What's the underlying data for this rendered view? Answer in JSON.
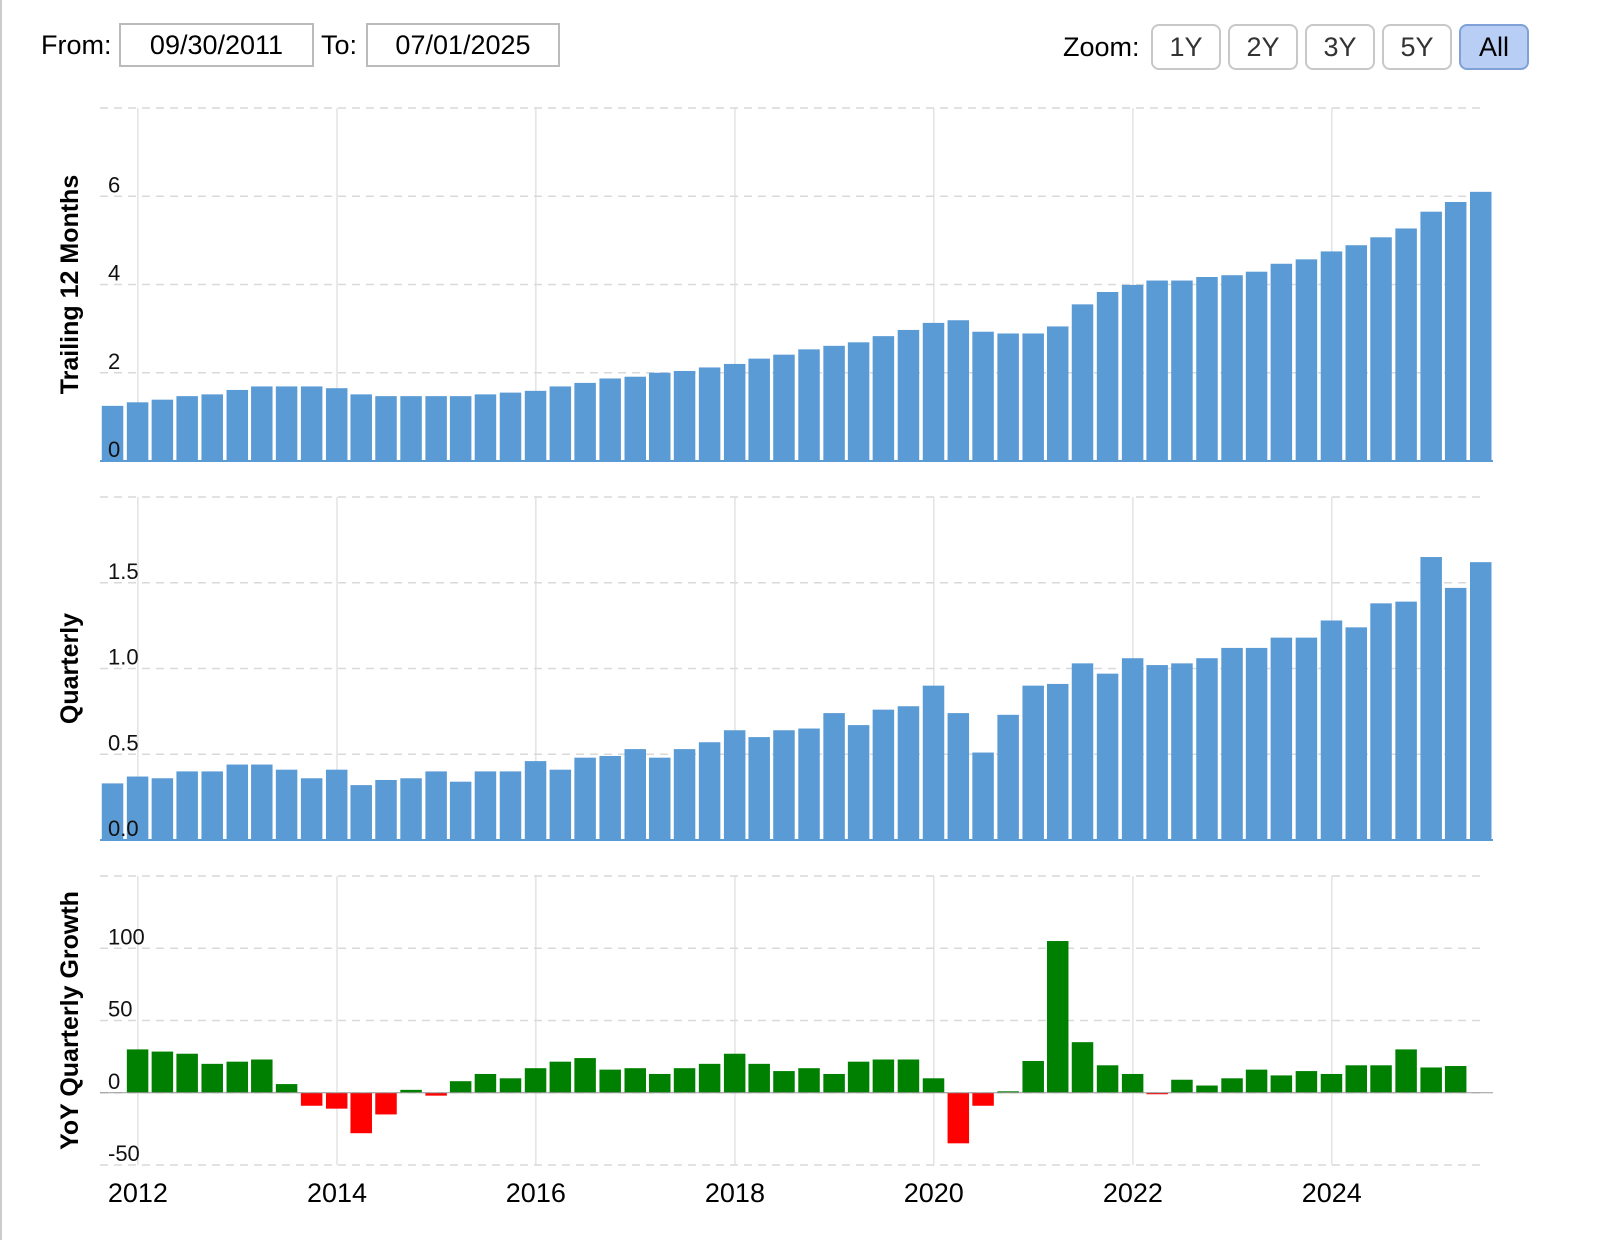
{
  "toolbar": {
    "from_label": "From:",
    "from_value": "09/30/2011",
    "to_label": "To:",
    "to_value": "07/01/2025",
    "zoom_label": "Zoom:",
    "zoom_options": [
      "1Y",
      "2Y",
      "3Y",
      "5Y",
      "All"
    ],
    "zoom_active": "All"
  },
  "colors": {
    "bar_blue": "#5b9bd5",
    "growth_positive": "#008000",
    "growth_negative": "#ff0000",
    "grid": "#d9d9d9",
    "active_zoom_bg": "#b8cef5"
  },
  "chart_data": [
    {
      "type": "bar",
      "ylabel": "Trailing 12 Months",
      "ylim": [
        0,
        8
      ],
      "yticks": [
        0,
        2,
        4,
        6
      ],
      "ytick_labels": [
        "0",
        "2",
        "4",
        "6"
      ],
      "xticks": [
        "2012",
        "2014",
        "2016",
        "2018",
        "2020",
        "2022",
        "2024"
      ],
      "grid": true,
      "x": [
        "2011-09-30",
        "2011-12-31",
        "2012-03-31",
        "2012-06-30",
        "2012-09-30",
        "2012-12-31",
        "2013-03-31",
        "2013-06-30",
        "2013-09-30",
        "2013-12-31",
        "2014-03-31",
        "2014-06-30",
        "2014-09-30",
        "2014-12-31",
        "2015-03-31",
        "2015-06-30",
        "2015-09-30",
        "2015-12-31",
        "2016-03-31",
        "2016-06-30",
        "2016-09-30",
        "2016-12-31",
        "2017-03-31",
        "2017-06-30",
        "2017-09-30",
        "2017-12-31",
        "2018-03-31",
        "2018-06-30",
        "2018-09-30",
        "2018-12-31",
        "2019-03-31",
        "2019-06-30",
        "2019-09-30",
        "2019-12-31",
        "2020-03-31",
        "2020-06-30",
        "2020-09-30",
        "2020-12-31",
        "2021-03-31",
        "2021-06-30",
        "2021-09-30",
        "2021-12-31",
        "2022-03-31",
        "2022-06-30",
        "2022-09-30",
        "2022-12-31",
        "2023-03-31",
        "2023-06-30",
        "2023-09-30",
        "2023-12-31",
        "2024-03-31",
        "2024-06-30",
        "2024-09-30",
        "2024-12-31",
        "2025-03-31",
        "2025-07-01"
      ],
      "values": [
        1.25,
        1.33,
        1.39,
        1.47,
        1.51,
        1.61,
        1.69,
        1.69,
        1.69,
        1.65,
        1.51,
        1.47,
        1.47,
        1.47,
        1.47,
        1.51,
        1.55,
        1.59,
        1.69,
        1.77,
        1.87,
        1.91,
        2.0,
        2.04,
        2.12,
        2.2,
        2.32,
        2.41,
        2.53,
        2.61,
        2.69,
        2.83,
        2.97,
        3.13,
        3.19,
        2.93,
        2.89,
        2.89,
        3.05,
        3.55,
        3.83,
        3.99,
        4.09,
        4.09,
        4.17,
        4.21,
        4.29,
        4.47,
        4.57,
        4.75,
        4.89,
        5.07,
        5.27,
        5.65,
        5.87,
        6.1
      ]
    },
    {
      "type": "bar",
      "ylabel": "Quarterly",
      "ylim": [
        0,
        2
      ],
      "yticks": [
        0,
        0.5,
        1.0,
        1.5
      ],
      "ytick_labels": [
        "0.0",
        "0.5",
        "1.0",
        "1.5"
      ],
      "xticks": [
        "2012",
        "2014",
        "2016",
        "2018",
        "2020",
        "2022",
        "2024"
      ],
      "grid": true,
      "x": [
        "2011-09-30",
        "2011-12-31",
        "2012-03-31",
        "2012-06-30",
        "2012-09-30",
        "2012-12-31",
        "2013-03-31",
        "2013-06-30",
        "2013-09-30",
        "2013-12-31",
        "2014-03-31",
        "2014-06-30",
        "2014-09-30",
        "2014-12-31",
        "2015-03-31",
        "2015-06-30",
        "2015-09-30",
        "2015-12-31",
        "2016-03-31",
        "2016-06-30",
        "2016-09-30",
        "2016-12-31",
        "2017-03-31",
        "2017-06-30",
        "2017-09-30",
        "2017-12-31",
        "2018-03-31",
        "2018-06-30",
        "2018-09-30",
        "2018-12-31",
        "2019-03-31",
        "2019-06-30",
        "2019-09-30",
        "2019-12-31",
        "2020-03-31",
        "2020-06-30",
        "2020-09-30",
        "2020-12-31",
        "2021-03-31",
        "2021-06-30",
        "2021-09-30",
        "2021-12-31",
        "2022-03-31",
        "2022-06-30",
        "2022-09-30",
        "2022-12-31",
        "2023-03-31",
        "2023-06-30",
        "2023-09-30",
        "2023-12-31",
        "2024-03-31",
        "2024-06-30",
        "2024-09-30",
        "2024-12-31",
        "2025-03-31",
        "2025-07-01"
      ],
      "values": [
        0.33,
        0.37,
        0.36,
        0.4,
        0.4,
        0.44,
        0.44,
        0.41,
        0.36,
        0.41,
        0.32,
        0.35,
        0.36,
        0.4,
        0.34,
        0.4,
        0.4,
        0.46,
        0.41,
        0.48,
        0.49,
        0.53,
        0.48,
        0.53,
        0.57,
        0.64,
        0.6,
        0.64,
        0.65,
        0.74,
        0.67,
        0.76,
        0.78,
        0.9,
        0.74,
        0.51,
        0.73,
        0.9,
        0.91,
        1.03,
        0.97,
        1.06,
        1.02,
        1.03,
        1.06,
        1.12,
        1.12,
        1.18,
        1.18,
        1.28,
        1.24,
        1.38,
        1.39,
        1.65,
        1.47,
        1.62
      ]
    },
    {
      "type": "bar",
      "ylabel": "YoY Quarterly Growth",
      "ylim": [
        -50,
        150
      ],
      "yticks": [
        -50,
        0,
        50,
        100
      ],
      "ytick_labels": [
        "-50",
        "0",
        "50",
        "100"
      ],
      "xticks": [
        "2012",
        "2014",
        "2016",
        "2018",
        "2020",
        "2022",
        "2024"
      ],
      "grid": true,
      "x": [
        "2011-12-31",
        "2012-03-31",
        "2012-06-30",
        "2012-09-30",
        "2012-12-31",
        "2013-03-31",
        "2013-06-30",
        "2013-09-30",
        "2013-12-31",
        "2014-03-31",
        "2014-06-30",
        "2014-09-30",
        "2014-12-31",
        "2015-03-31",
        "2015-06-30",
        "2015-09-30",
        "2015-12-31",
        "2016-03-31",
        "2016-06-30",
        "2016-09-30",
        "2016-12-31",
        "2017-03-31",
        "2017-06-30",
        "2017-09-30",
        "2017-12-31",
        "2018-03-31",
        "2018-06-30",
        "2018-09-30",
        "2018-12-31",
        "2019-03-31",
        "2019-06-30",
        "2019-09-30",
        "2019-12-31",
        "2020-03-31",
        "2020-06-30",
        "2020-09-30",
        "2020-12-31",
        "2021-03-31",
        "2021-06-30",
        "2021-09-30",
        "2021-12-31",
        "2022-03-31",
        "2022-06-30",
        "2022-09-30",
        "2022-12-31",
        "2023-03-31",
        "2023-06-30",
        "2023-09-30",
        "2023-12-31",
        "2024-03-31",
        "2024-06-30",
        "2024-09-30",
        "2024-12-31",
        "2025-03-31",
        "2025-07-01"
      ],
      "values": [
        30,
        28.5,
        27,
        20,
        21.5,
        23,
        6,
        -9,
        -11,
        -28,
        -15,
        2,
        -2,
        8,
        13,
        10,
        17,
        21.5,
        24,
        16,
        17,
        13,
        17,
        20,
        27,
        20,
        15,
        17,
        13,
        21.5,
        23,
        23,
        10,
        -35,
        -9,
        1,
        22,
        105,
        35,
        19,
        13,
        -1,
        9,
        5,
        10,
        16,
        12,
        15,
        13,
        19,
        19,
        30,
        17.5,
        18.5
      ]
    }
  ]
}
